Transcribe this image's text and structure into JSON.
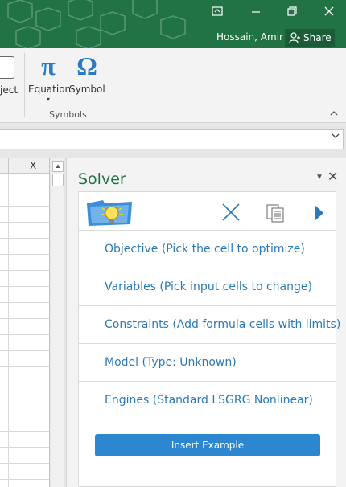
{
  "titlebar": {
    "user_name": "Hossain, Amir",
    "share_label": "Share",
    "window_buttons": [
      "ribbon-display-icon",
      "minimize-icon",
      "restore-icon",
      "close-icon"
    ]
  },
  "ribbon": {
    "object_label": "ject",
    "equation_label": "Equation",
    "equation_glyph": "π",
    "symbol_label": "Symbol",
    "symbol_glyph": "Ω",
    "group_label": "Symbols"
  },
  "sheet": {
    "column_letter": "X"
  },
  "taskpane": {
    "title": "Solver",
    "rows": [
      {
        "label": "Objective (Pick the cell to optimize)"
      },
      {
        "label": "Variables (Pick input cells to change)"
      },
      {
        "label": "Constraints (Add formula cells with limits)"
      },
      {
        "label": "Model (Type: Unknown)"
      },
      {
        "label": "Engines (Standard LSGRG Nonlinear)"
      }
    ],
    "insert_example_label": "Insert Example"
  },
  "colors": {
    "excel_green": "#217346",
    "solver_blue": "#2a7ab8",
    "button_blue": "#2d86d0"
  }
}
